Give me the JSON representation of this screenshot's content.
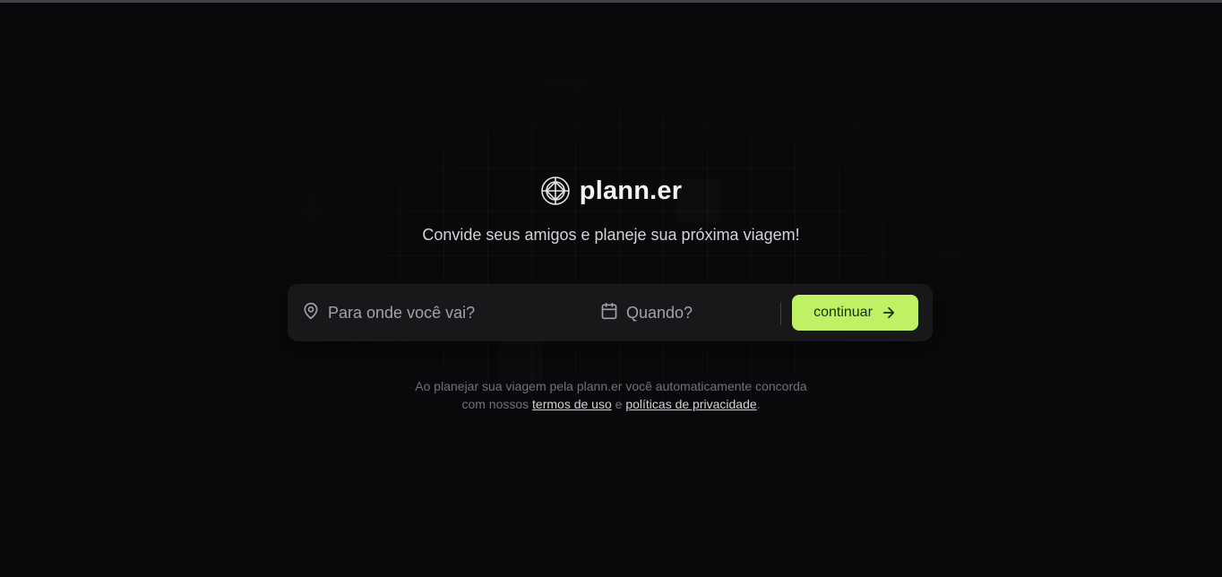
{
  "brand": {
    "name": "plann.er",
    "icon": "globe-icon"
  },
  "tagline": "Convide seus amigos e planeje sua próxima viagem!",
  "search": {
    "destination_placeholder": "Para onde você vai?",
    "destination_icon": "map-pin-icon",
    "date_placeholder": "Quando?",
    "date_icon": "calendar-icon",
    "continue_label": "continuar",
    "continue_icon": "arrow-right-icon"
  },
  "legal": {
    "line1": "Ao planejar sua viagem pela plann.er você automaticamente concorda",
    "line2_prefix": "com nossos",
    "terms_link": "termos de uso",
    "conjunction": "e",
    "privacy_link": "políticas de privacidade",
    "suffix": "."
  },
  "colors": {
    "background": "#09090b",
    "surface": "#18181b",
    "accent": "#bef264",
    "accent_text": "#1a2e05",
    "text_primary": "#f4f4f5",
    "text_muted": "#71717a"
  }
}
